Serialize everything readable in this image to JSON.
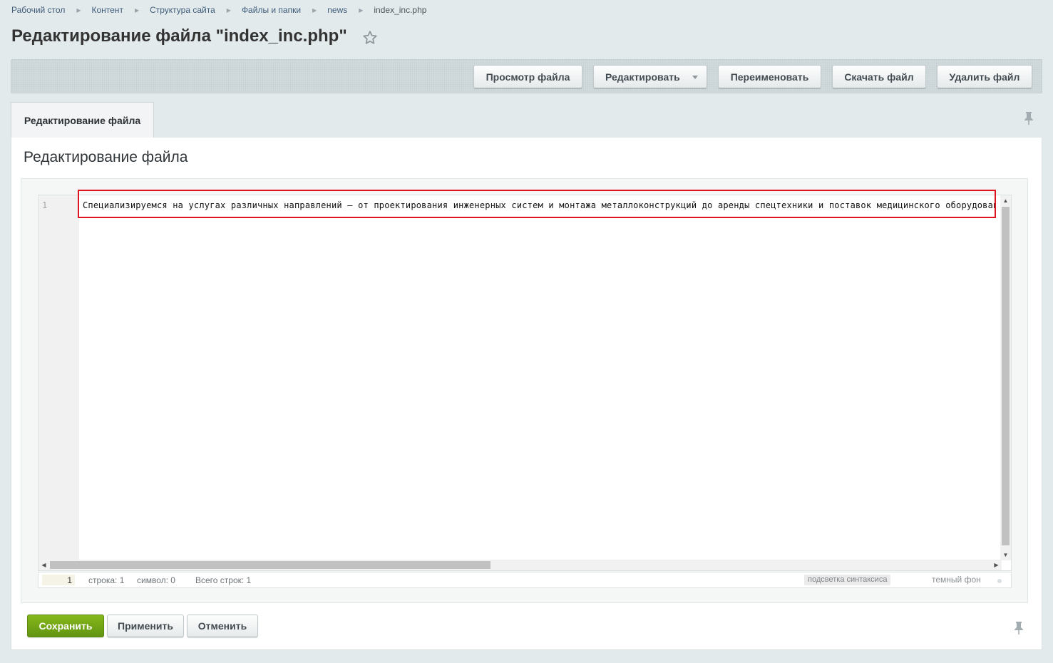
{
  "breadcrumb": {
    "items": [
      "Рабочий стол",
      "Контент",
      "Структура сайта",
      "Файлы и папки",
      "news"
    ],
    "current": "index_inc.php",
    "separator": "▶"
  },
  "page": {
    "title": "Редактирование файла \"index_inc.php\"",
    "favorite_icon": "star-icon"
  },
  "toolbar": {
    "view_label": "Просмотр файла",
    "edit_label": "Редактировать",
    "rename_label": "Переименовать",
    "download_label": "Скачать файл",
    "delete_label": "Удалить файл"
  },
  "tabs": [
    {
      "label": "Редактирование файла",
      "active": true
    }
  ],
  "section": {
    "title": "Редактирование файла"
  },
  "editor": {
    "lines": [
      {
        "number": "1",
        "text": "Специализируемся на услугах различных направлений – от проектирования инженерных систем и монтажа металлоконструкций до аренды спецтехники и поставок медицинского оборудования"
      }
    ]
  },
  "status_bar": {
    "goto_line_value": "1",
    "line_label": "строка: 1",
    "char_label": "символ: 0",
    "total_label": "Всего строк: 1",
    "syntax_label": "подсветка синтаксиса",
    "dark_label": "темный фон"
  },
  "actions": {
    "save_label": "Сохранить",
    "apply_label": "Применить",
    "cancel_label": "Отменить"
  },
  "colors": {
    "save_button": "#6fa315",
    "highlight_border": "#e0141e",
    "background": "#e3eaec"
  }
}
